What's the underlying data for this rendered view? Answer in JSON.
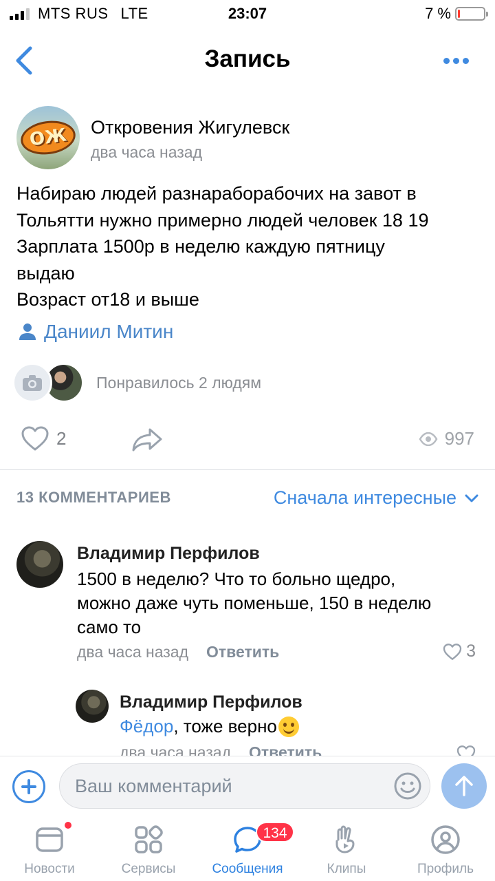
{
  "status_bar": {
    "carrier": "MTS RUS",
    "network": "LTE",
    "time": "23:07",
    "battery_percent": "7 %",
    "battery_level": 0.07
  },
  "navbar": {
    "title": "Запись"
  },
  "post": {
    "group_name": "Откровения Жигулевск",
    "group_logo_text": "ОЖ",
    "time": "два часа назад",
    "text": "Набираю людей разнараборабочих на завот в\nТольятти нужно примерно людей человек 18 19\nЗарплата 1500р в неделю каждую пятницу\nвыдаю\nВозраст от18 и выше",
    "author": "Даниил Митин",
    "likes_text": "Понравилось 2 людям",
    "like_count": "2",
    "views": "997"
  },
  "comments_header": {
    "count_label": "13 КОММЕНТАРИЕВ",
    "sort_label": "Сначала интересные"
  },
  "comments": [
    {
      "name": "Владимир Перфилов",
      "text": "1500 в неделю? Что то больно щедро,\nможно даже чуть поменьше, 150 в неделю\nсамо то",
      "time": "два часа назад",
      "reply_label": "Ответить",
      "likes": "3"
    }
  ],
  "reply": {
    "name": "Владимир Перфилов",
    "mention": "Фёдор",
    "text": ", тоже верно",
    "time": "два часа назад",
    "reply_label": "Ответить"
  },
  "input": {
    "placeholder": "Ваш комментарий"
  },
  "tabs": [
    {
      "label": "Новости",
      "icon": "news-icon"
    },
    {
      "label": "Сервисы",
      "icon": "services-icon"
    },
    {
      "label": "Сообщения",
      "icon": "messages-icon",
      "badge": "134",
      "active": true
    },
    {
      "label": "Клипы",
      "icon": "clips-icon"
    },
    {
      "label": "Профиль",
      "icon": "profile-icon"
    }
  ],
  "colors": {
    "accent": "#3f8ae0",
    "badge": "#ff3347",
    "secondary_text": "#8b8e93"
  }
}
